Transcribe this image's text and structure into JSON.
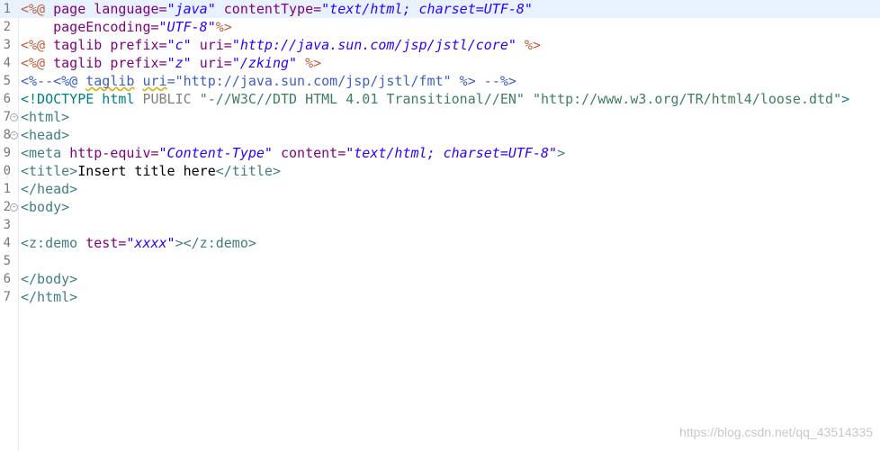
{
  "editor": {
    "lines": [
      {
        "num": "1",
        "current": true,
        "fold": false,
        "tokens": [
          {
            "t": "<%@",
            "c": "s-dir"
          },
          {
            "t": " ",
            "c": "s-pln"
          },
          {
            "t": "page",
            "c": "s-att"
          },
          {
            "t": " ",
            "c": "s-pln"
          },
          {
            "t": "language=",
            "c": "s-att"
          },
          {
            "t": "\"java\"",
            "c": "s-str"
          },
          {
            "t": " ",
            "c": "s-pln"
          },
          {
            "t": "contentType=",
            "c": "s-att"
          },
          {
            "t": "\"text/html; charset=UTF-8\"",
            "c": "s-str"
          }
        ]
      },
      {
        "num": "2",
        "current": false,
        "fold": false,
        "tokens": [
          {
            "t": "    pageEncoding=",
            "c": "s-att"
          },
          {
            "t": "\"UTF-8\"",
            "c": "s-str"
          },
          {
            "t": "%>",
            "c": "s-dir"
          }
        ]
      },
      {
        "num": "3",
        "current": false,
        "fold": false,
        "tokens": [
          {
            "t": "<%@",
            "c": "s-dir"
          },
          {
            "t": " ",
            "c": "s-pln"
          },
          {
            "t": "taglib",
            "c": "s-att"
          },
          {
            "t": " ",
            "c": "s-pln"
          },
          {
            "t": "prefix=",
            "c": "s-att"
          },
          {
            "t": "\"c\"",
            "c": "s-str"
          },
          {
            "t": " ",
            "c": "s-pln"
          },
          {
            "t": "uri=",
            "c": "s-att"
          },
          {
            "t": "\"http://java.sun.com/jsp/jstl/core\"",
            "c": "s-str"
          },
          {
            "t": " ",
            "c": "s-pln"
          },
          {
            "t": "%>",
            "c": "s-dir"
          }
        ]
      },
      {
        "num": "4",
        "current": false,
        "fold": false,
        "tokens": [
          {
            "t": "<%@",
            "c": "s-dir"
          },
          {
            "t": " ",
            "c": "s-pln"
          },
          {
            "t": "taglib",
            "c": "s-att"
          },
          {
            "t": " ",
            "c": "s-pln"
          },
          {
            "t": "prefix=",
            "c": "s-att"
          },
          {
            "t": "\"z\"",
            "c": "s-str"
          },
          {
            "t": " ",
            "c": "s-pln"
          },
          {
            "t": "uri=",
            "c": "s-att"
          },
          {
            "t": "\"/zking\"",
            "c": "s-str"
          },
          {
            "t": " ",
            "c": "s-pln"
          },
          {
            "t": "%>",
            "c": "s-dir"
          }
        ]
      },
      {
        "num": "5",
        "current": false,
        "fold": false,
        "tokens": [
          {
            "t": "<%--",
            "c": "s-cmt"
          },
          {
            "t": "<%@ ",
            "c": "s-cmt"
          },
          {
            "t": "taglib",
            "c": "s-cmt squig"
          },
          {
            "t": " ",
            "c": "s-cmt"
          },
          {
            "t": "uri",
            "c": "s-cmt squig"
          },
          {
            "t": "=\"http://java.sun.com/jsp/jstl/fmt\" %> --%>",
            "c": "s-cmt"
          }
        ]
      },
      {
        "num": "6",
        "current": false,
        "fold": false,
        "tokens": [
          {
            "t": "<!DOCTYPE html ",
            "c": "s-dt"
          },
          {
            "t": "PUBLIC ",
            "c": "s-pub"
          },
          {
            "t": "\"-//W3C//DTD HTML 4.01 Transitional//EN\" \"http://www.w3.org/TR/html4/loose.dtd\"",
            "c": "s-dtstr"
          },
          {
            "t": ">",
            "c": "s-dt"
          }
        ]
      },
      {
        "num": "7",
        "current": false,
        "fold": true,
        "tokens": [
          {
            "t": "<html>",
            "c": "s-tag"
          }
        ]
      },
      {
        "num": "8",
        "current": false,
        "fold": true,
        "tokens": [
          {
            "t": "<head>",
            "c": "s-tag"
          }
        ]
      },
      {
        "num": "9",
        "current": false,
        "fold": false,
        "tokens": [
          {
            "t": "<meta",
            "c": "s-tag"
          },
          {
            "t": " ",
            "c": "s-pln"
          },
          {
            "t": "http-equiv=",
            "c": "s-att"
          },
          {
            "t": "\"Content-Type\"",
            "c": "s-str"
          },
          {
            "t": " ",
            "c": "s-pln"
          },
          {
            "t": "content=",
            "c": "s-att"
          },
          {
            "t": "\"text/html; charset=UTF-8\"",
            "c": "s-str"
          },
          {
            "t": ">",
            "c": "s-tag"
          }
        ]
      },
      {
        "num": "0",
        "current": false,
        "fold": false,
        "tokens": [
          {
            "t": "<title>",
            "c": "s-tag"
          },
          {
            "t": "Insert title here",
            "c": "s-pln"
          },
          {
            "t": "</title>",
            "c": "s-tag"
          }
        ]
      },
      {
        "num": "1",
        "current": false,
        "fold": false,
        "tokens": [
          {
            "t": "</head>",
            "c": "s-tag"
          }
        ]
      },
      {
        "num": "2",
        "current": false,
        "fold": true,
        "tokens": [
          {
            "t": "<body>",
            "c": "s-tag"
          }
        ]
      },
      {
        "num": "3",
        "current": false,
        "fold": false,
        "tokens": []
      },
      {
        "num": "4",
        "current": false,
        "fold": false,
        "tokens": [
          {
            "t": "<z:demo",
            "c": "s-tag"
          },
          {
            "t": " ",
            "c": "s-pln"
          },
          {
            "t": "test=",
            "c": "s-att"
          },
          {
            "t": "\"xxxx\"",
            "c": "s-str"
          },
          {
            "t": ">",
            "c": "s-tag"
          },
          {
            "t": "</z:demo>",
            "c": "s-tag"
          }
        ]
      },
      {
        "num": "5",
        "current": false,
        "fold": false,
        "tokens": []
      },
      {
        "num": "6",
        "current": false,
        "fold": false,
        "tokens": [
          {
            "t": "</body>",
            "c": "s-tag"
          }
        ]
      },
      {
        "num": "7",
        "current": false,
        "fold": false,
        "tokens": [
          {
            "t": "</html>",
            "c": "s-tag"
          }
        ]
      }
    ]
  },
  "watermark": "https://blog.csdn.net/qq_43514335",
  "colors": {
    "current_line": "#e8f2fe",
    "jsp_directive": "#bf5f3f",
    "attribute": "#7f007f",
    "string": "#2a00ff",
    "tag": "#3f7f7f",
    "comment": "#3f5fbf"
  }
}
